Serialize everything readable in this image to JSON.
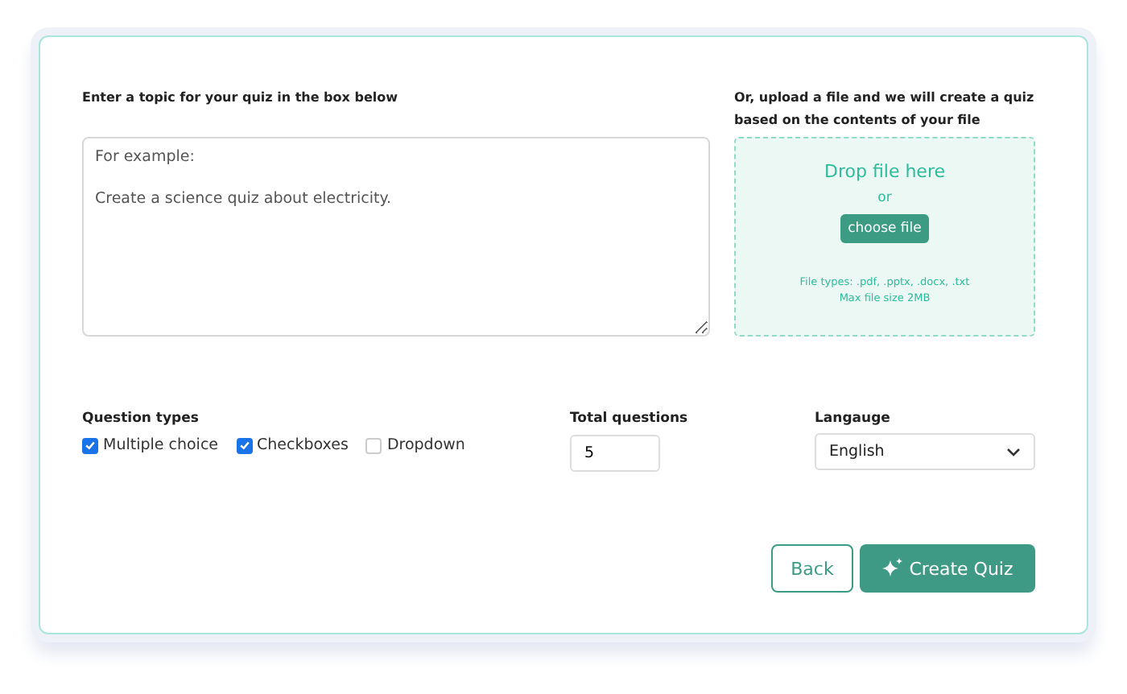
{
  "topic": {
    "label": "Enter a topic for your quiz in the box below",
    "placeholder": "For example:\n\nCreate a science quiz about electricity."
  },
  "upload": {
    "label": "Or, upload a file and we will create a quiz based on the contents of your file",
    "drop_text": "Drop file here",
    "or_text": "or",
    "button": "choose file",
    "file_types": "File types: .pdf, .pptx, .docx, .txt",
    "max_size": "Max file size 2MB"
  },
  "question_types": {
    "label": "Question types",
    "options": [
      {
        "label": "Multiple choice",
        "checked": true
      },
      {
        "label": "Checkboxes",
        "checked": true
      },
      {
        "label": "Dropdown",
        "checked": false
      }
    ]
  },
  "total_questions": {
    "label": "Total questions",
    "value": "5"
  },
  "language": {
    "label": "Langauge",
    "value": "English"
  },
  "buttons": {
    "back": "Back",
    "create": "Create Quiz"
  }
}
